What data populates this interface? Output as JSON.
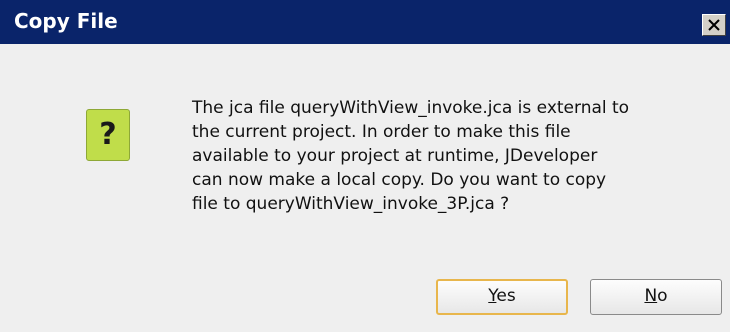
{
  "window": {
    "title": "Copy File",
    "close_icon": "close-icon"
  },
  "icon": {
    "name": "question-icon",
    "glyph": "?",
    "color": "#c0dd4a"
  },
  "message": {
    "lines": [
      "The jca file queryWithView_invoke.jca is external to",
      "the current project. In order to make this file",
      "available to your project at runtime, JDeveloper",
      "can now make a local copy. Do you want to copy",
      "file to queryWithView_invoke_3P.jca ?"
    ]
  },
  "buttons": {
    "yes": {
      "mnemonic": "Y",
      "rest": "es"
    },
    "no": {
      "mnemonic": "N",
      "rest": "o"
    }
  },
  "colors": {
    "title_bar": "#0a246a",
    "dialog_bg": "#efefef",
    "default_button_border": "#e8b64c"
  }
}
